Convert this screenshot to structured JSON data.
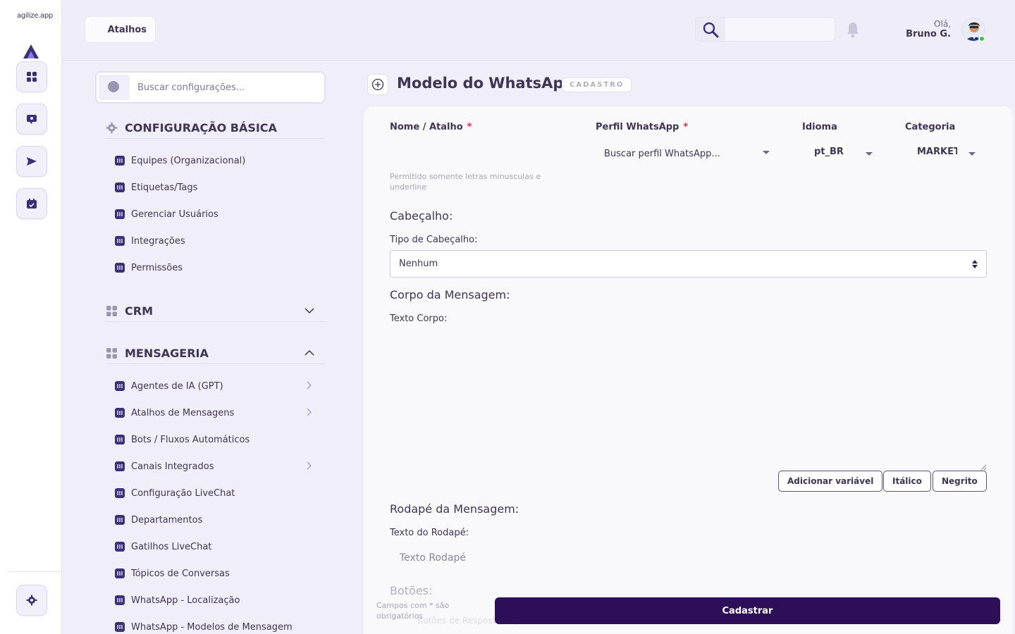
{
  "app": {
    "logo_text": "agilize.app"
  },
  "topbar": {
    "shortcuts_label": "Atalhos",
    "search_value": "",
    "greeting": "Olá,",
    "user_name": "Bruno G."
  },
  "settings": {
    "search_placeholder": "Buscar configurações...",
    "sections": {
      "basic": {
        "title": "CONFIGURAÇÃO BÁSICA",
        "items": [
          "Equipes (Organizacional)",
          "Etiquetas/Tags",
          "Gerenciar Usuários",
          "Integrações",
          "Permissões"
        ]
      },
      "crm": {
        "title": "CRM"
      },
      "messaging": {
        "title": "MENSAGERIA",
        "items": [
          "Agentes de IA (GPT)",
          "Atalhos de Mensagens",
          "Bots / Fluxos Automáticos",
          "Canais Integrados",
          "Configuração LiveChat",
          "Departamentos",
          "Gatilhos LiveChat",
          "Tópicos de Conversas",
          "WhatsApp - Localização",
          "WhatsApp - Modelos de Mensagem"
        ]
      }
    }
  },
  "form": {
    "title": "Modelo do WhatsApp",
    "badge": "CADASTRO",
    "name_label": "Nome / Atalho",
    "name_value": "",
    "name_hint": "Permitido somente letras minusculas e underline",
    "profile_label": "Perfil WhatsApp",
    "profile_placeholder": "Buscar perfil WhatsApp...",
    "language_label": "Idioma",
    "language_value": "pt_BR",
    "category_label": "Categoria",
    "category_value": "MARKETI",
    "required_mark": "*",
    "header_title": "Cabeçalho:",
    "header_type_label": "Tipo de Cabeçalho:",
    "header_type_value": "Nenhum",
    "body_title": "Corpo da Mensagem:",
    "body_label": "Texto Corpo:",
    "add_variable": "Adicionar variável",
    "italic": "Itálico",
    "bold": "Negrito",
    "footer_title": "Rodapé da Mensagem:",
    "footer_label": "Texto do Rodapé:",
    "footer_placeholder": "Texto Rodapé",
    "buttons_title": "Botões:",
    "buttons_row_text": "Botões de Resposta Rápida",
    "required_note": "Campos com * são obrigatórios",
    "submit": "Cadastrar"
  },
  "colors": {
    "accent": "#2c0f57",
    "required": "#e0284e",
    "online": "#2ecc40"
  }
}
